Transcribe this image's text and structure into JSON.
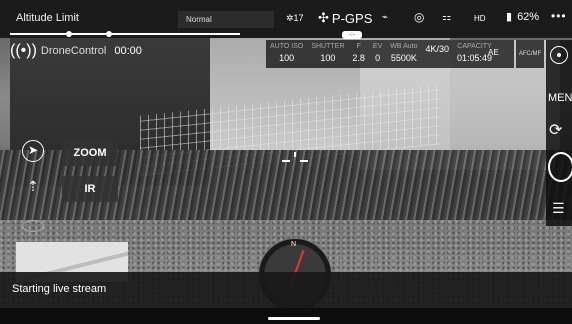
{
  "topbar": {
    "altitude_limit": "Altitude Limit",
    "flight_mode_value": "Normal",
    "satellites": "17",
    "gps_mode": "P-GPS",
    "hd_signal": "HD",
    "battery_percent": "62%",
    "more": "•••",
    "drag_tab": "-:-"
  },
  "live": {
    "brand": "DroneControl",
    "timer": "00:00"
  },
  "camera_params": [
    {
      "label": "AUTO ISO",
      "value": "100"
    },
    {
      "label": "SHUTTER",
      "value": "100"
    },
    {
      "label": "F",
      "value": "2.8"
    },
    {
      "label": "EV",
      "value": "0"
    },
    {
      "label": "WB Auto",
      "value": "5500K"
    },
    {
      "label": "",
      "value": "4K/30"
    },
    {
      "label": "CAPACITY",
      "value": "01:05:49"
    }
  ],
  "ae_label": "AE",
  "af_mf_label": "AFC/MF",
  "right_panel": {
    "menu_label": "MENU"
  },
  "left_panel": {
    "zoom_label": "ZOOM",
    "ir_label": "IR"
  },
  "attitude": {
    "north": "N"
  },
  "toast": {
    "message": "Starting live stream"
  }
}
